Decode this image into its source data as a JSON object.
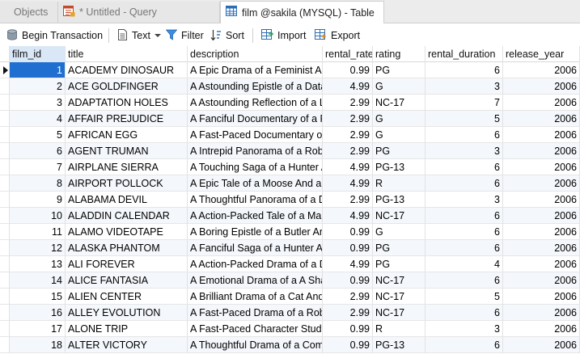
{
  "tabs": [
    {
      "label": "Objects",
      "icon": "objects-icon"
    },
    {
      "label": "* Untitled - Query",
      "icon": "query-icon"
    },
    {
      "label": "film @sakila (MYSQL) - Table",
      "icon": "table-icon"
    }
  ],
  "toolbar": {
    "begin_transaction": "Begin Transaction",
    "text": "Text",
    "filter": "Filter",
    "sort": "Sort",
    "import": "Import",
    "export": "Export"
  },
  "colors": {
    "selection": "#1f6fd1",
    "header_selected": "#d9e7f7",
    "alt_row": "#f4f7fb"
  },
  "table": {
    "columns": [
      "film_id",
      "title",
      "description",
      "rental_rate",
      "rating",
      "rental_duration",
      "release_year"
    ],
    "rows": [
      [
        "1",
        "ACADEMY DINOSAUR",
        "A Epic Drama of a Feminist And",
        "0.99",
        "PG",
        "6",
        "2006"
      ],
      [
        "2",
        "ACE GOLDFINGER",
        "A Astounding Epistle of a Datab",
        "4.99",
        "G",
        "3",
        "2006"
      ],
      [
        "3",
        "ADAPTATION HOLES",
        "A Astounding Reflection of a Lu",
        "2.99",
        "NC-17",
        "7",
        "2006"
      ],
      [
        "4",
        "AFFAIR PREJUDICE",
        "A Fanciful Documentary of a Fr",
        "2.99",
        "G",
        "5",
        "2006"
      ],
      [
        "5",
        "AFRICAN EGG",
        "A Fast-Paced Documentary of a",
        "2.99",
        "G",
        "6",
        "2006"
      ],
      [
        "6",
        "AGENT TRUMAN",
        "A Intrepid Panorama of a Robo",
        "2.99",
        "PG",
        "3",
        "2006"
      ],
      [
        "7",
        "AIRPLANE SIERRA",
        "A Touching Saga of a Hunter A",
        "4.99",
        "PG-13",
        "6",
        "2006"
      ],
      [
        "8",
        "AIRPORT POLLOCK",
        "A Epic Tale of a Moose And a G",
        "4.99",
        "R",
        "6",
        "2006"
      ],
      [
        "9",
        "ALABAMA DEVIL",
        "A Thoughtful Panorama of a D",
        "2.99",
        "PG-13",
        "3",
        "2006"
      ],
      [
        "10",
        "ALADDIN CALENDAR",
        "A Action-Packed Tale of a Man",
        "4.99",
        "NC-17",
        "6",
        "2006"
      ],
      [
        "11",
        "ALAMO VIDEOTAPE",
        "A Boring Epistle of a Butler An",
        "0.99",
        "G",
        "6",
        "2006"
      ],
      [
        "12",
        "ALASKA PHANTOM",
        "A Fanciful Saga of a Hunter An",
        "0.99",
        "PG",
        "6",
        "2006"
      ],
      [
        "13",
        "ALI FOREVER",
        "A Action-Packed Drama of a De",
        "4.99",
        "PG",
        "4",
        "2006"
      ],
      [
        "14",
        "ALICE FANTASIA",
        "A Emotional Drama of a A Shar",
        "0.99",
        "NC-17",
        "6",
        "2006"
      ],
      [
        "15",
        "ALIEN CENTER",
        "A Brilliant Drama of a Cat And a",
        "2.99",
        "NC-17",
        "5",
        "2006"
      ],
      [
        "16",
        "ALLEY EVOLUTION",
        "A Fast-Paced Drama of a Robo",
        "2.99",
        "NC-17",
        "6",
        "2006"
      ],
      [
        "17",
        "ALONE TRIP",
        "A Fast-Paced Character Study o",
        "0.99",
        "R",
        "3",
        "2006"
      ],
      [
        "18",
        "ALTER VICTORY",
        "A Thoughtful Drama of a Comp",
        "0.99",
        "PG-13",
        "6",
        "2006"
      ]
    ]
  }
}
